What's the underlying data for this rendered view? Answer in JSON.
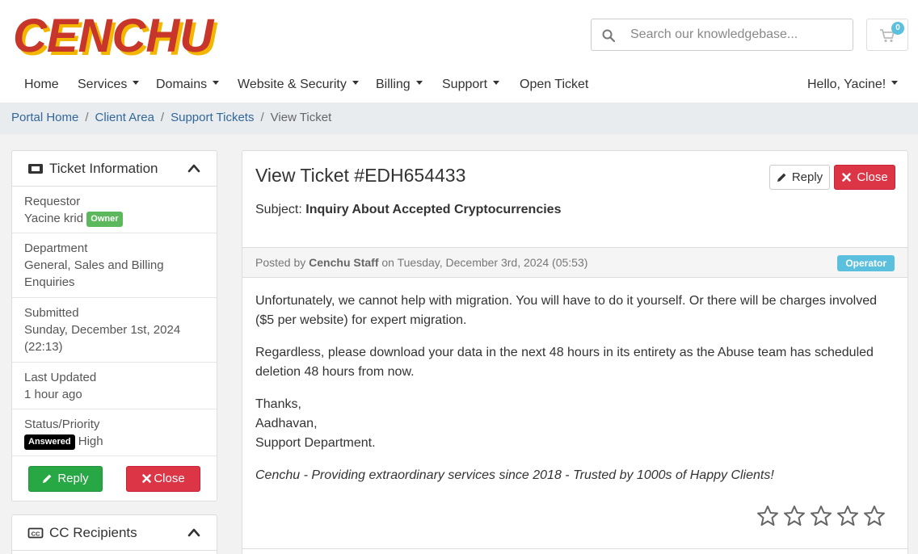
{
  "brand": {
    "name": "CENCHU",
    "color": "#c8362b",
    "shadow": "#f2b600"
  },
  "search": {
    "placeholder": "Search our knowledgebase..."
  },
  "cart": {
    "count": "0"
  },
  "nav": {
    "items": [
      {
        "label": "Home",
        "dropdown": false
      },
      {
        "label": "Services",
        "dropdown": true
      },
      {
        "label": "Domains",
        "dropdown": true
      },
      {
        "label": "Website & Security",
        "dropdown": true
      },
      {
        "label": "Billing",
        "dropdown": true
      },
      {
        "label": "Support",
        "dropdown": true
      },
      {
        "label": "Open Ticket",
        "dropdown": false
      }
    ],
    "user": "Hello, Yacine!"
  },
  "breadcrumb": {
    "items": [
      "Portal Home",
      "Client Area",
      "Support Tickets"
    ],
    "current": "View Ticket"
  },
  "sidebar": {
    "title": "Ticket Information",
    "requestor_label": "Requestor",
    "requestor_name": "Yacine krid",
    "owner_badge": "Owner",
    "department_label": "Department",
    "department_value": "General, Sales and Billing Enquiries",
    "submitted_label": "Submitted",
    "submitted_value": "Sunday, December 1st, 2024 (22:13)",
    "updated_label": "Last Updated",
    "updated_value": "1 hour ago",
    "status_label": "Status/Priority",
    "status_badge": "Answered",
    "priority": "High",
    "reply_label": "Reply",
    "close_label": "Close",
    "cc_title": "CC Recipients"
  },
  "ticket": {
    "title": "View Ticket #EDH654433",
    "reply_label": "Reply",
    "close_label": "Close",
    "subject_label": "Subject:",
    "subject": "Inquiry About Accepted Cryptocurrencies",
    "post": {
      "prefix": "Posted by",
      "author": "Cenchu Staff",
      "date_text": "on Tuesday, December 3rd, 2024 (05:53)",
      "role": "Operator"
    },
    "message": {
      "p1": "Unfortunately, we cannot help with migration. You will have to do it yourself. Or there will be charges involved ($5 per website) for expert migration.",
      "p2": "Regardless, please download your data in the next 48 hours in its entirety as the Abuse team has scheduled deletion 48 hours from now.",
      "p3_l1": "Thanks,",
      "p3_l2": "Aadhavan,",
      "p3_l3": "Support Department.",
      "signature": "Cenchu - Providing extraordinary services since 2018 - Trusted by 1000s of Happy Clients!"
    },
    "rating": {
      "max": 5,
      "value": 0
    }
  },
  "colors": {
    "link": "#336699",
    "green": "#28a745",
    "red": "#dc3545",
    "info": "#5bc0de"
  }
}
